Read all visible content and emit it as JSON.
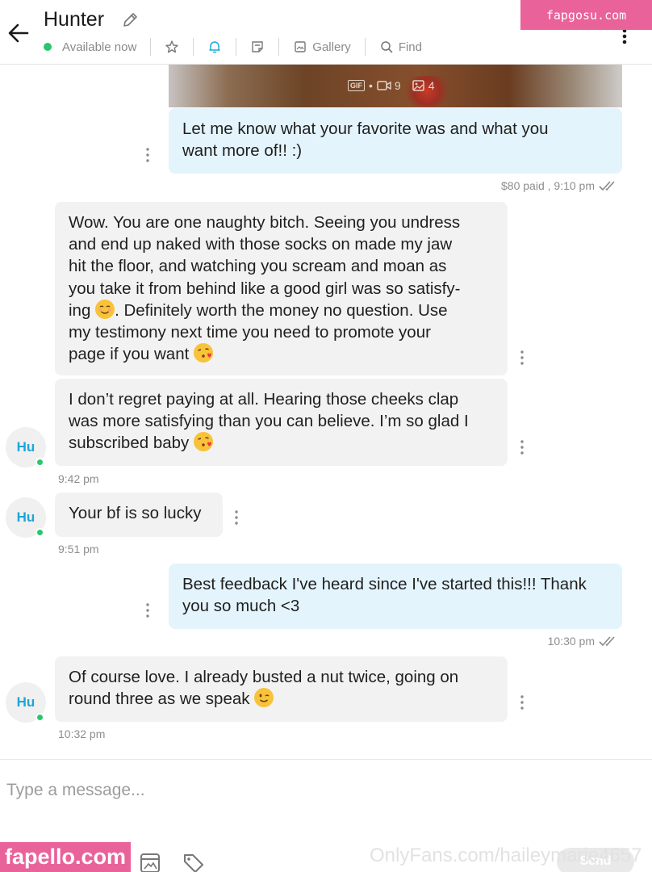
{
  "header": {
    "title": "Hunter",
    "status": "Available now",
    "gallery_label": "Gallery",
    "find_label": "Find",
    "icons": [
      "back-arrow-icon",
      "pencil-icon",
      "star-icon",
      "bell-icon",
      "note-icon",
      "gallery-icon",
      "search-icon",
      "more-vertical-icon"
    ]
  },
  "watermarks": {
    "top": "fapgosu.com",
    "bottom": "fapello.com",
    "url": "OnlyFans.com/haileymarie4657"
  },
  "media": {
    "gif_label": "GIF",
    "video_count": "9",
    "photo_count": "4"
  },
  "messages": [
    {
      "direction": "outgoing",
      "text": "Let me know what your favorite was and what you\nwant more of!! :)"
    },
    {
      "direction": "incoming",
      "text": "Wow. You are one naughty bitch. Seeing you undress\nand end up naked with those socks on made my jaw\nhit the floor, and watching you scream and moan as\nyou take it from behind like a good girl was so satisfy-\ning ",
      "text_after_emoji": ". Definitely worth the money no question. Use\nmy testimony next time you need to promote your\npage if you want "
    },
    {
      "direction": "incoming",
      "text": "I don’t regret paying at all. Hearing those cheeks clap\nwas more satisfying than you can believe. I’m so glad I\nsubscribed baby "
    },
    {
      "direction": "incoming",
      "text": "Your bf is so lucky"
    },
    {
      "direction": "outgoing",
      "text": "Best feedback I've heard since I've started this!!! Thank\nyou so much <3"
    },
    {
      "direction": "incoming",
      "text": "Of course love. I already busted a nut twice, going on\nround three as we speak "
    }
  ],
  "meta": {
    "paid_time": "$80 paid ,  9:10 pm",
    "time_942": "9:42 pm",
    "time_951": "9:51 pm",
    "time_1030": "10:30 pm",
    "time_1032": "10:32 pm"
  },
  "avatar_initials": "Hu",
  "composer": {
    "placeholder": "Type a message...",
    "send_label": "Send"
  },
  "colors": {
    "outgoing_bubble": "#e4f4fd",
    "incoming_bubble": "#f2f2f3",
    "online": "#28c76f",
    "accent": "#1da5d8",
    "watermark": "#e9629a"
  }
}
